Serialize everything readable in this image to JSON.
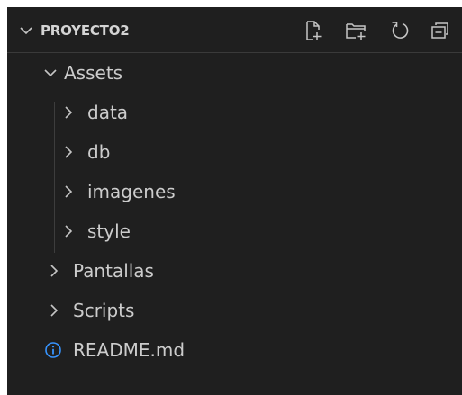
{
  "explorer": {
    "section_title": "PROYECTO2",
    "actions": {
      "new_file": "new-file-icon",
      "new_folder": "new-folder-icon",
      "refresh": "refresh-icon",
      "collapse_all": "collapse-all-icon"
    }
  },
  "tree": {
    "assets": "Assets",
    "data": "data",
    "db": "db",
    "imagenes": "imagenes",
    "style": "style",
    "pantallas": "Pantallas",
    "scripts": "Scripts",
    "readme": "README.md"
  },
  "colors": {
    "background": "#1f1f1f",
    "text": "#cccccc",
    "icon": "#c5c5c5",
    "info_icon": "#3794ff"
  }
}
